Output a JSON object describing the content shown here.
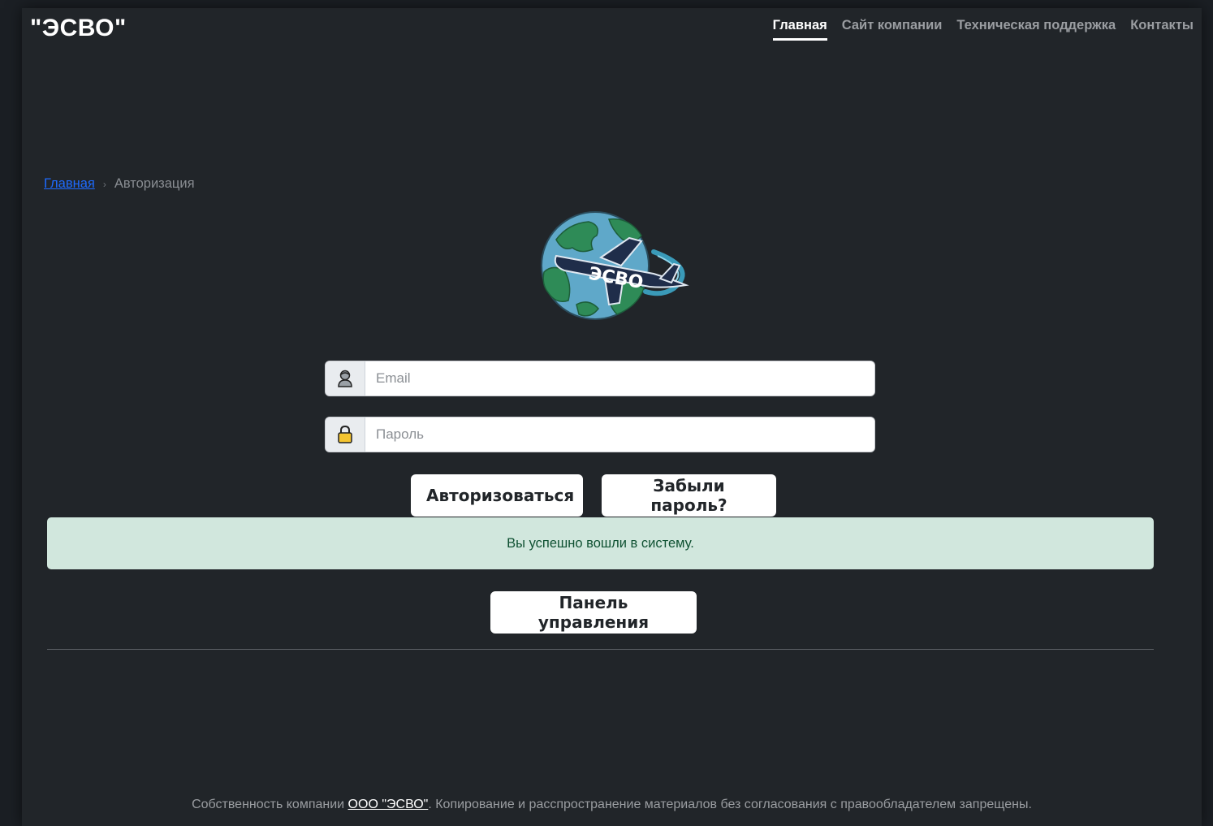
{
  "header": {
    "brand": "\"ЭСВО\"",
    "nav": [
      {
        "label": "Главная",
        "active": true
      },
      {
        "label": "Сайт компании",
        "active": false
      },
      {
        "label": "Техническая поддержка",
        "active": false
      },
      {
        "label": "Контакты",
        "active": false
      }
    ]
  },
  "breadcrumb": {
    "home": "Главная",
    "separator": "›",
    "current": "Авторизация"
  },
  "logo": {
    "text": "ЭСВО",
    "icon": "globe-airplane-logo"
  },
  "form": {
    "email": {
      "placeholder": "Email",
      "value": "",
      "icon": "user-icon"
    },
    "password": {
      "placeholder": "Пароль",
      "value": "",
      "icon": "lock-icon"
    },
    "login_button": "Авторизоваться",
    "forgot_button": "Забыли пароль?"
  },
  "alert": {
    "text": "Вы успешно вошли в систему.",
    "color": "#d1e7dd"
  },
  "dashboard_button": "Панель управления",
  "footer": {
    "prefix": "Собственность компании ",
    "company_link": "ООО \"ЭСВО\"",
    "suffix": ". Копирование и расспространение материалов без согласования с правообладателем запрещены."
  },
  "colors": {
    "background": "#212529",
    "link": "#1e6bff",
    "alert_text": "#0f5132"
  }
}
